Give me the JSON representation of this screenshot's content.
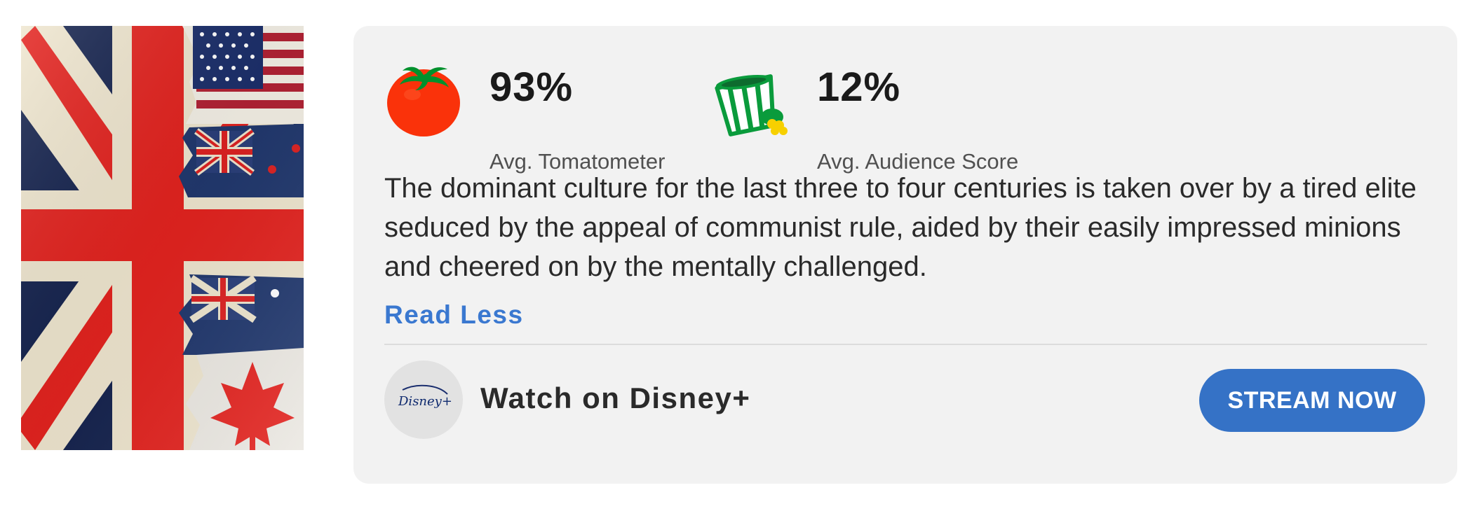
{
  "poster": {
    "alt": "Flags poster",
    "icon": "union-jack-flags-poster"
  },
  "scores": {
    "tomatometer": {
      "value": "93%",
      "label": "Avg. Tomatometer",
      "icon": "fresh-tomato-icon",
      "color": "#fa320a"
    },
    "audience": {
      "value": "12%",
      "label": "Avg. Audience Score",
      "icon": "spilled-popcorn-icon",
      "color": "#0a9b3c"
    }
  },
  "description": "The dominant culture for the last three to four centuries is taken over by a tired elite seduced by the appeal of communist rule, aided by their easily impressed minions and cheered on by the mentally challenged.",
  "read_less_label": "Read Less",
  "provider": {
    "logo_text": "Disney+",
    "watch_label": "Watch on Disney+",
    "button_label": "STREAM NOW",
    "button_color": "#3572c6"
  }
}
